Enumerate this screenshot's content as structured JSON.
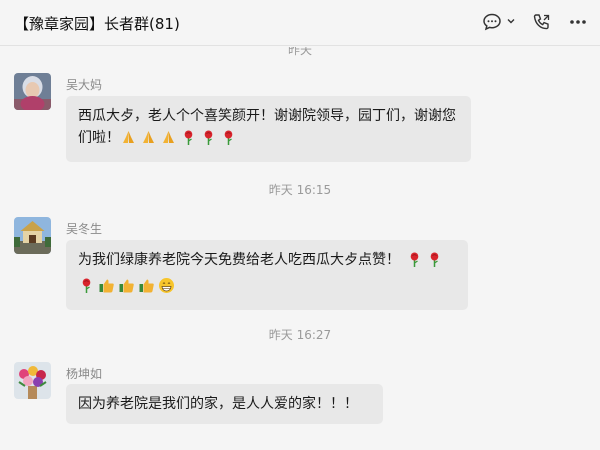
{
  "header": {
    "title": "【豫章家园】长者群(81)",
    "icons": [
      "chat-bubble-icon",
      "chevron-down-icon",
      "phone-icon",
      "more-icon"
    ]
  },
  "chat": {
    "partial_timestamp": "昨天",
    "messages": [
      {
        "sender": "吴大妈",
        "text": "西瓜大歺，老人个个喜笑颜开！谢谢院领导，园丁们，谢谢您们啦！",
        "emoji": [
          "praying-hands",
          "praying-hands",
          "praying-hands",
          "rose",
          "rose",
          "rose"
        ]
      },
      {
        "timestamp": "昨天 16:15",
        "sender": "吴冬生",
        "text": "为我们绿康养老院今天免费给老人吃西瓜大歺点赞！",
        "emoji_inline": [
          "rose",
          "rose"
        ],
        "emoji_line2": [
          "rose",
          "thumbs-up",
          "thumbs-up",
          "thumbs-up",
          "grin-face"
        ]
      },
      {
        "timestamp": "昨天 16:27",
        "sender": "杨坤如",
        "text": "因为养老院是我们的家，是人人爱的家！！！"
      }
    ]
  }
}
